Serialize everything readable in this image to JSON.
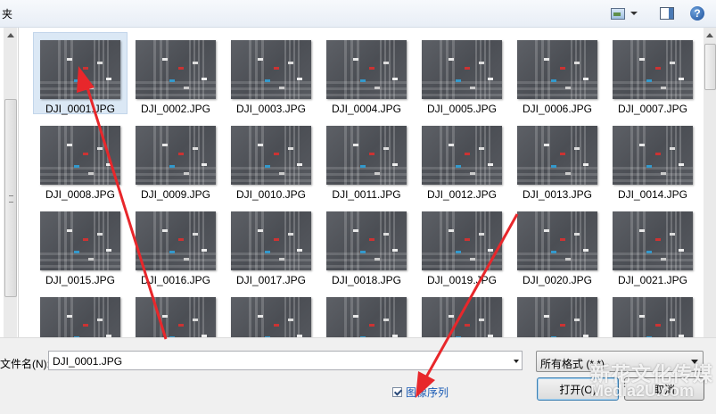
{
  "toolbar": {
    "crumb": "夹",
    "view_icon": "change-view-icon",
    "pane_icon": "preview-pane-icon",
    "help_label": "?"
  },
  "files": [
    "DJI_0001.JPG",
    "DJI_0002.JPG",
    "DJI_0003.JPG",
    "DJI_0004.JPG",
    "DJI_0005.JPG",
    "DJI_0006.JPG",
    "DJI_0007.JPG",
    "DJI_0008.JPG",
    "DJI_0009.JPG",
    "DJI_0010.JPG",
    "DJI_0011.JPG",
    "DJI_0012.JPG",
    "DJI_0013.JPG",
    "DJI_0014.JPG",
    "DJI_0015.JPG",
    "DJI_0016.JPG",
    "DJI_0017.JPG",
    "DJI_0018.JPG",
    "DJI_0019.JPG",
    "DJI_0020.JPG",
    "DJI_0021.JPG",
    "",
    "",
    "",
    "",
    "",
    "",
    ""
  ],
  "selected_index": 0,
  "bottom": {
    "filename_label": "文件名(N):",
    "filename_value": "DJI_0001.JPG",
    "format_value": "所有格式 (*.*)",
    "sequence_label": "图像序列",
    "sequence_checked": true,
    "open_label": "打开(O)",
    "cancel_label": "取消"
  },
  "watermark": {
    "line1": "新花文化传媒",
    "line2": "Media2U.com"
  },
  "colors": {
    "annotation_arrow": "#e8272b",
    "selected_bg": "#dbe8f5",
    "link_blue": "#1a5bb5"
  }
}
